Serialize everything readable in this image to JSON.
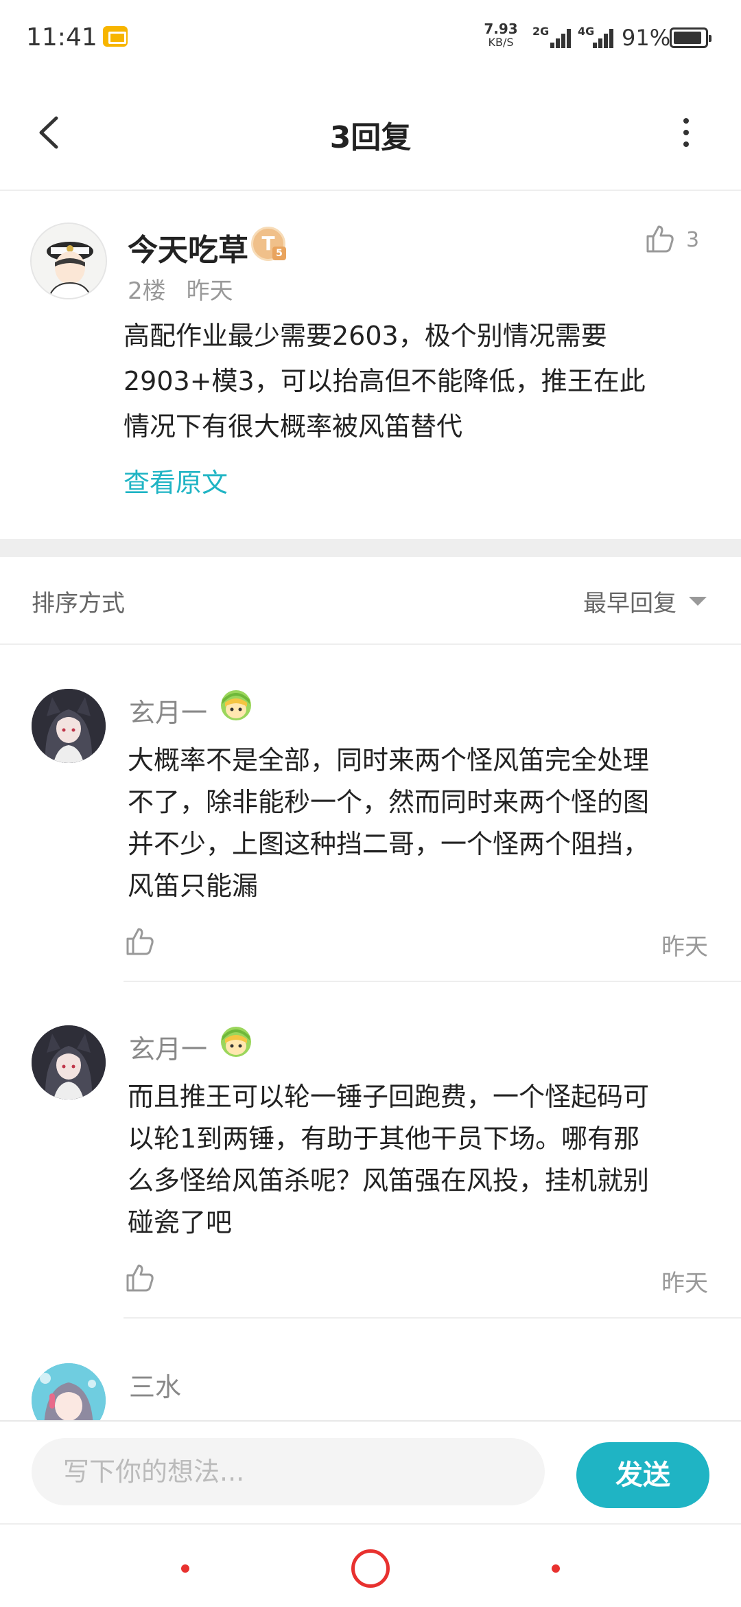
{
  "status_bar": {
    "time": "11:41",
    "speed_value": "7.93",
    "speed_unit": "KB/S",
    "net_1": "2G",
    "net_2": "4G",
    "battery_text": "91%",
    "battery_level": 0.91,
    "notification_icon": "mail-icon"
  },
  "header": {
    "title": "3回复",
    "back_icon": "back-arrow-icon",
    "more_icon": "more-vertical-icon"
  },
  "post": {
    "author": "今天吃草",
    "badge": "T",
    "badge_sub": "5",
    "floor": "2楼",
    "time": "昨天",
    "likes": "3",
    "lines": [
      "高配作业最少需要2603，极个别情况需要",
      "2903+模3，可以抬高但不能降低，推王在此",
      "情况下有很大概率被风笛替代"
    ],
    "view_original": "查看原文"
  },
  "sort": {
    "label": "排序方式",
    "value": "最早回复"
  },
  "replies": [
    {
      "author": "玄月一",
      "lines": [
        "大概率不是全部，同时来两个怪风笛完全处理",
        "不了，除非能秒一个，然而同时来两个怪的图",
        "并不少，上图这种挡二哥，一个怪两个阻挡，",
        "风笛只能漏"
      ],
      "time": "昨天"
    },
    {
      "author": "玄月一",
      "lines": [
        "而且推王可以轮一锤子回跑费，一个怪起码可",
        "以轮1到两锤，有助于其他干员下场。哪有那",
        "么多怪给风笛杀呢？风笛强在风投，挂机就别",
        "碰瓷了吧"
      ],
      "time": "昨天"
    },
    {
      "author": "三水"
    }
  ],
  "input": {
    "placeholder": "写下你的想法...",
    "send": "发送"
  },
  "colors": {
    "accent": "#1fb4c4",
    "nav_red": "#e8312f",
    "meta_gray": "#999999"
  }
}
